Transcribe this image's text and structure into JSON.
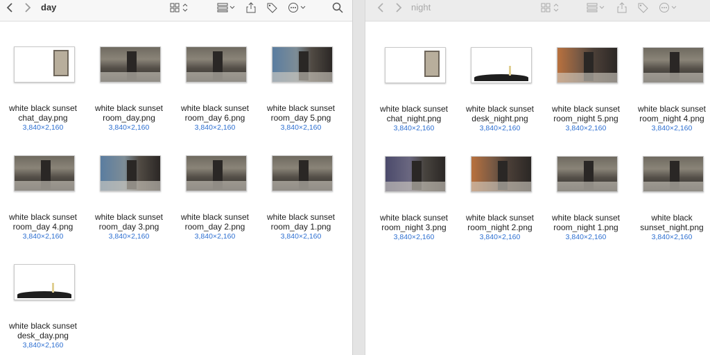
{
  "left": {
    "title": "day",
    "icons": {
      "back": "chevron-left-icon",
      "forward": "chevron-right-icon",
      "view": "icon-grid-icon",
      "group": "group-icon",
      "share": "share-icon",
      "tag": "tag-icon",
      "more": "more-icon",
      "search": "search-icon"
    },
    "files": [
      {
        "name": "white black sunset chat_day.png",
        "dims": "3,840×2,160"
      },
      {
        "name": "white black sunset room_day.png",
        "dims": "3,840×2,160"
      },
      {
        "name": "white black sunset room_day 6.png",
        "dims": "3,840×2,160"
      },
      {
        "name": "white black sunset room_day 5.png",
        "dims": "3,840×2,160"
      },
      {
        "name": "white black sunset room_day 4.png",
        "dims": "3,840×2,160"
      },
      {
        "name": "white black sunset room_day 3.png",
        "dims": "3,840×2,160"
      },
      {
        "name": "white black sunset room_day 2.png",
        "dims": "3,840×2,160"
      },
      {
        "name": "white black sunset room_day 1.png",
        "dims": "3,840×2,160"
      },
      {
        "name": "white black sunset desk_day.png",
        "dims": "3,840×2,160"
      }
    ]
  },
  "right": {
    "title": "night",
    "files": [
      {
        "name": "white black sunset chat_night.png",
        "dims": "3,840×2,160"
      },
      {
        "name": "white black sunset desk_night.png",
        "dims": "3,840×2,160"
      },
      {
        "name": "white black sunset room_night 5.png",
        "dims": "3,840×2,160"
      },
      {
        "name": "white black sunset room_night 4.png",
        "dims": "3,840×2,160"
      },
      {
        "name": "white black sunset room_night 3.png",
        "dims": "3,840×2,160"
      },
      {
        "name": "white black sunset room_night 2.png",
        "dims": "3,840×2,160"
      },
      {
        "name": "white black sunset room_night 1.png",
        "dims": "3,840×2,160"
      },
      {
        "name": "white black sunset_night.png",
        "dims": "3,840×2,160"
      }
    ]
  }
}
